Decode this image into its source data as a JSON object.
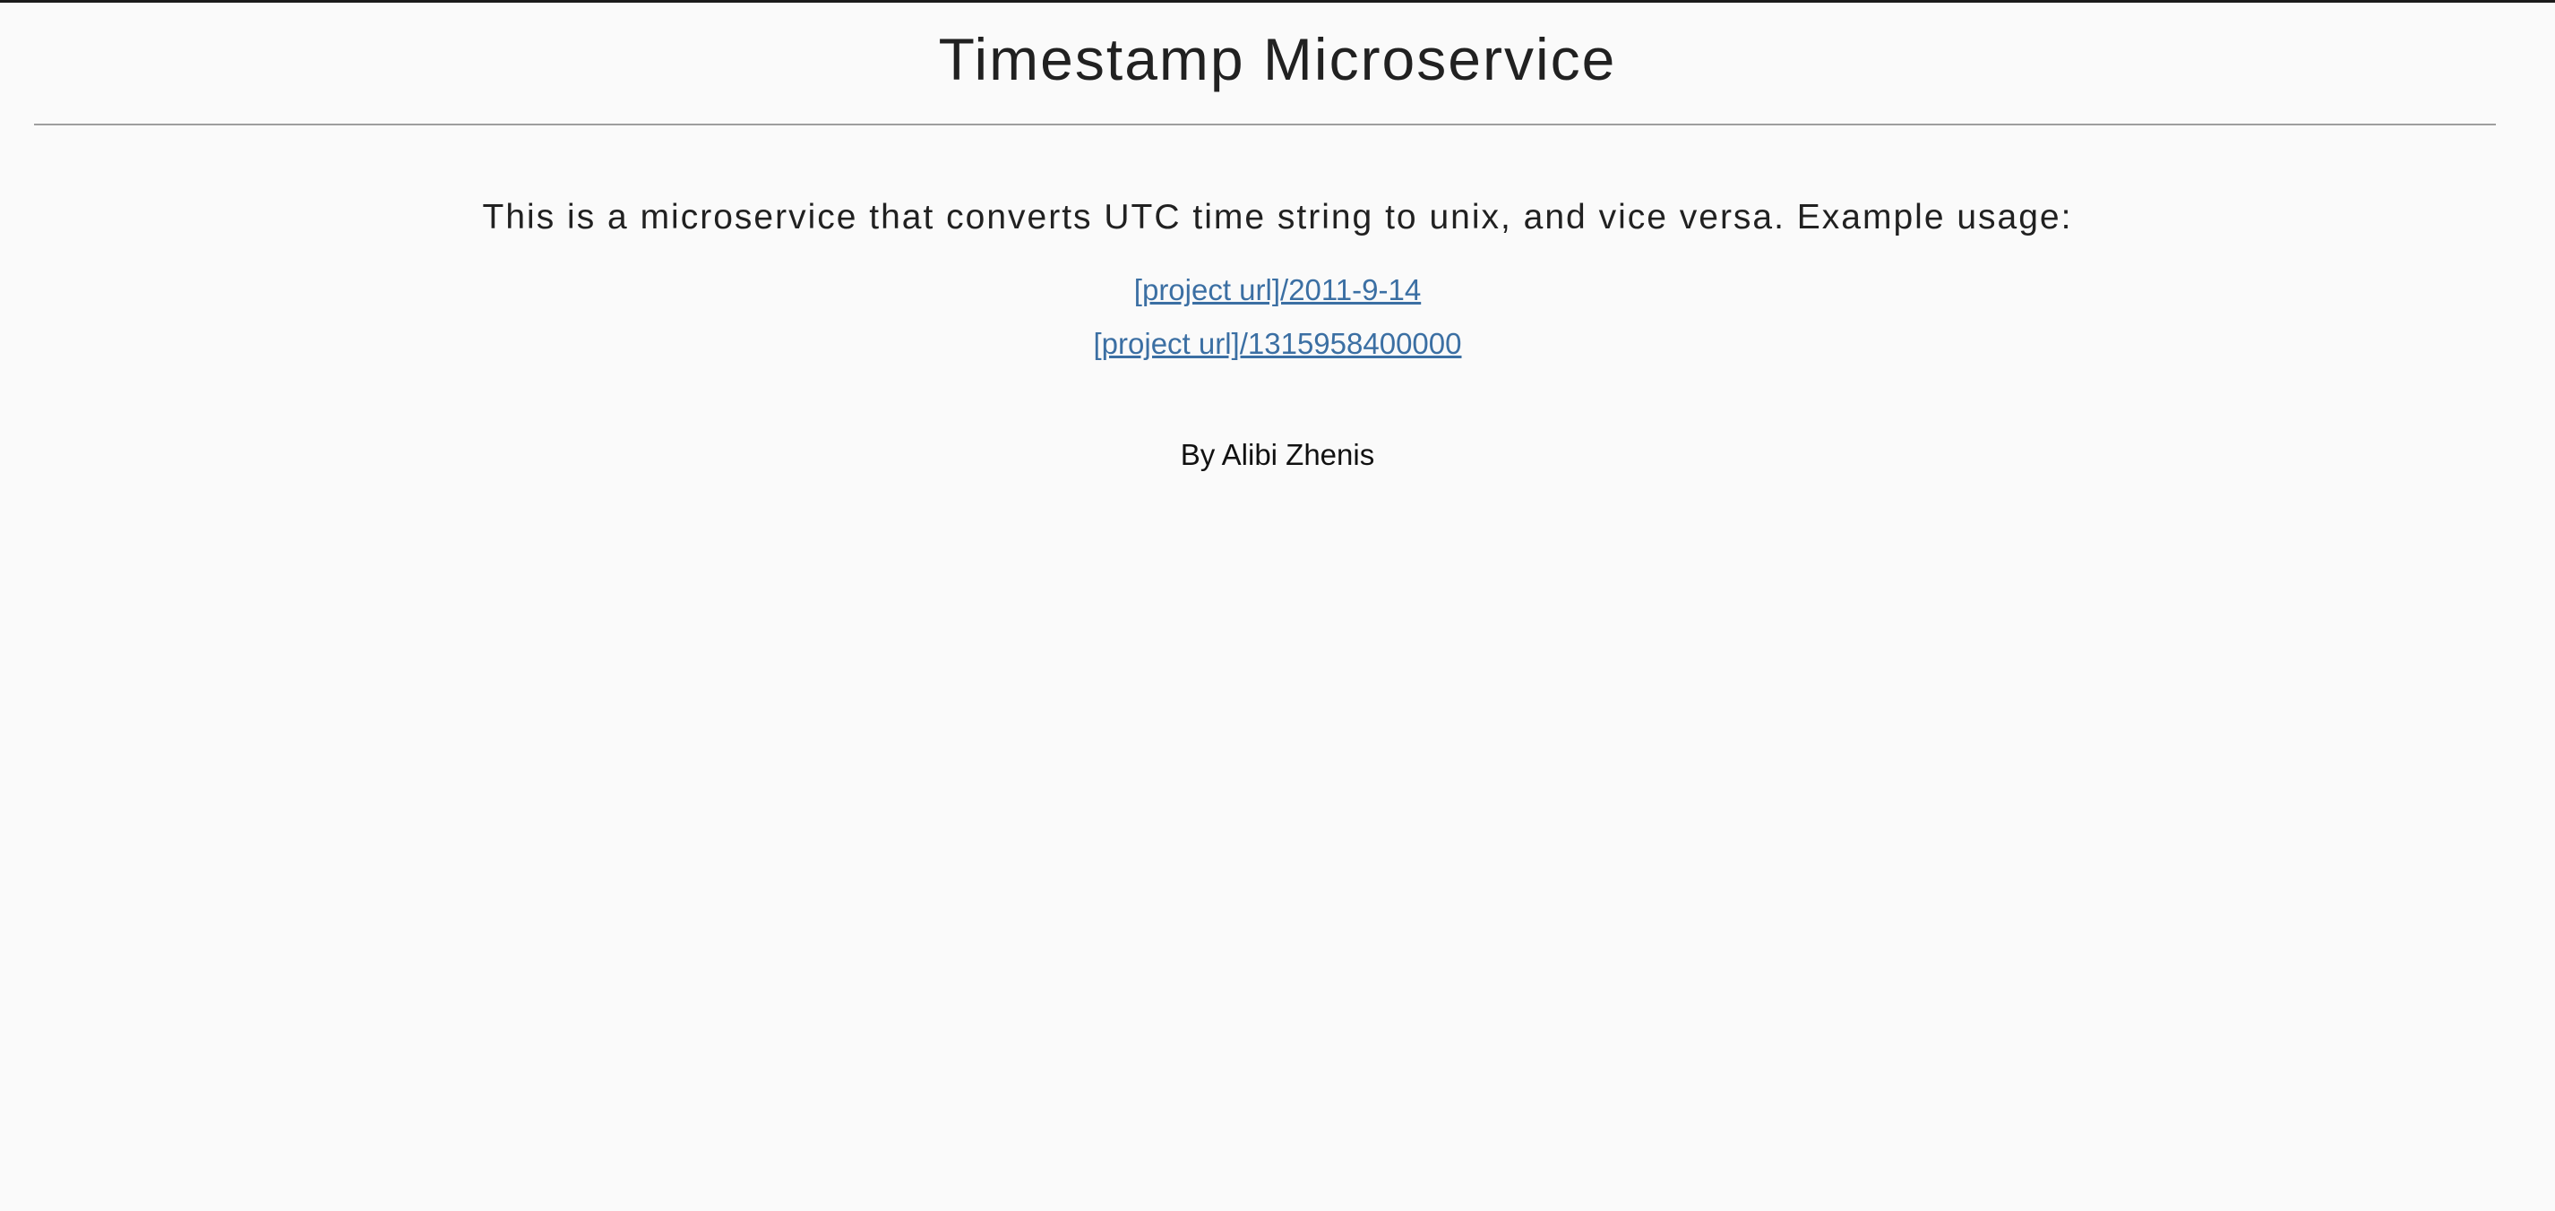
{
  "header": {
    "title": "Timestamp Microservice"
  },
  "main": {
    "description": "This is a microservice that converts UTC time string to unix, and vice versa. Example usage:",
    "examples": [
      {
        "label": "[project url]/2011-9-14"
      },
      {
        "label": "[project url]/1315958400000"
      }
    ]
  },
  "footer": {
    "author": "By Alibi Zhenis"
  },
  "colors": {
    "background": "#fafafa",
    "text": "#212121",
    "link": "#3b6fa3",
    "divider": "#9e9e9e"
  }
}
